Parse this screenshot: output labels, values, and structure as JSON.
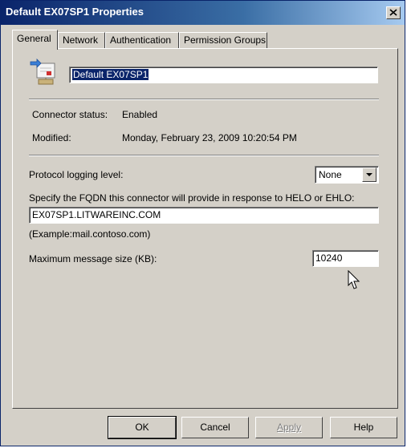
{
  "window": {
    "title": "Default EX07SP1 Properties"
  },
  "tabs": [
    {
      "label": "General"
    },
    {
      "label": "Network"
    },
    {
      "label": "Authentication"
    },
    {
      "label": "Permission Groups"
    }
  ],
  "general": {
    "name_value": "Default EX07SP1",
    "connector_status_label": "Connector status:",
    "connector_status_value": "Enabled",
    "modified_label": "Modified:",
    "modified_value": "Monday, February 23, 2009 10:20:54 PM",
    "protocol_logging_label": "Protocol logging level:",
    "protocol_logging_value": "None",
    "fqdn_label": "Specify the FQDN this connector will provide in response to HELO or EHLO:",
    "fqdn_value": "EX07SP1.LITWAREINC.COM",
    "fqdn_example": "(Example:mail.contoso.com)",
    "max_size_label": "Maximum message size (KB):",
    "max_size_value": "10240"
  },
  "buttons": {
    "ok": "OK",
    "cancel": "Cancel",
    "apply": "Apply",
    "help": "Help"
  }
}
